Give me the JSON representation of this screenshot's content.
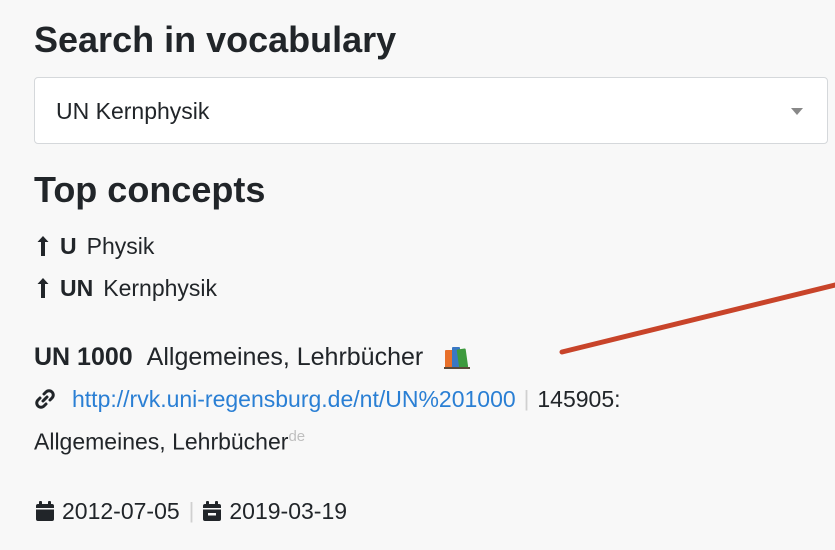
{
  "search": {
    "heading": "Search in vocabulary",
    "selected_vocabulary": "UN Kernphysik"
  },
  "top_concepts": {
    "heading": "Top concepts",
    "items": [
      {
        "notation": "U",
        "label": "Physik"
      },
      {
        "notation": "UN",
        "label": "Kernphysik"
      }
    ]
  },
  "detail": {
    "notation": "UN 1000",
    "label": "Allgemeines, Lehrbücher",
    "uri": "http://rvk.uni-regensburg.de/nt/UN%201000",
    "id_prefix": "145905:",
    "pref_label": "Allgemeines, Lehrbücher",
    "language": "de",
    "created": "2012-07-05",
    "modified": "2019-03-19"
  },
  "icons": {
    "up_arrow": "arrow-up-icon",
    "books": "books-icon",
    "link": "link-icon",
    "calendar": "calendar-icon",
    "calendar_modified": "calendar-minus-icon"
  },
  "colors": {
    "link": "#2a7fd4",
    "annotation_arrow": "#c8442a"
  }
}
